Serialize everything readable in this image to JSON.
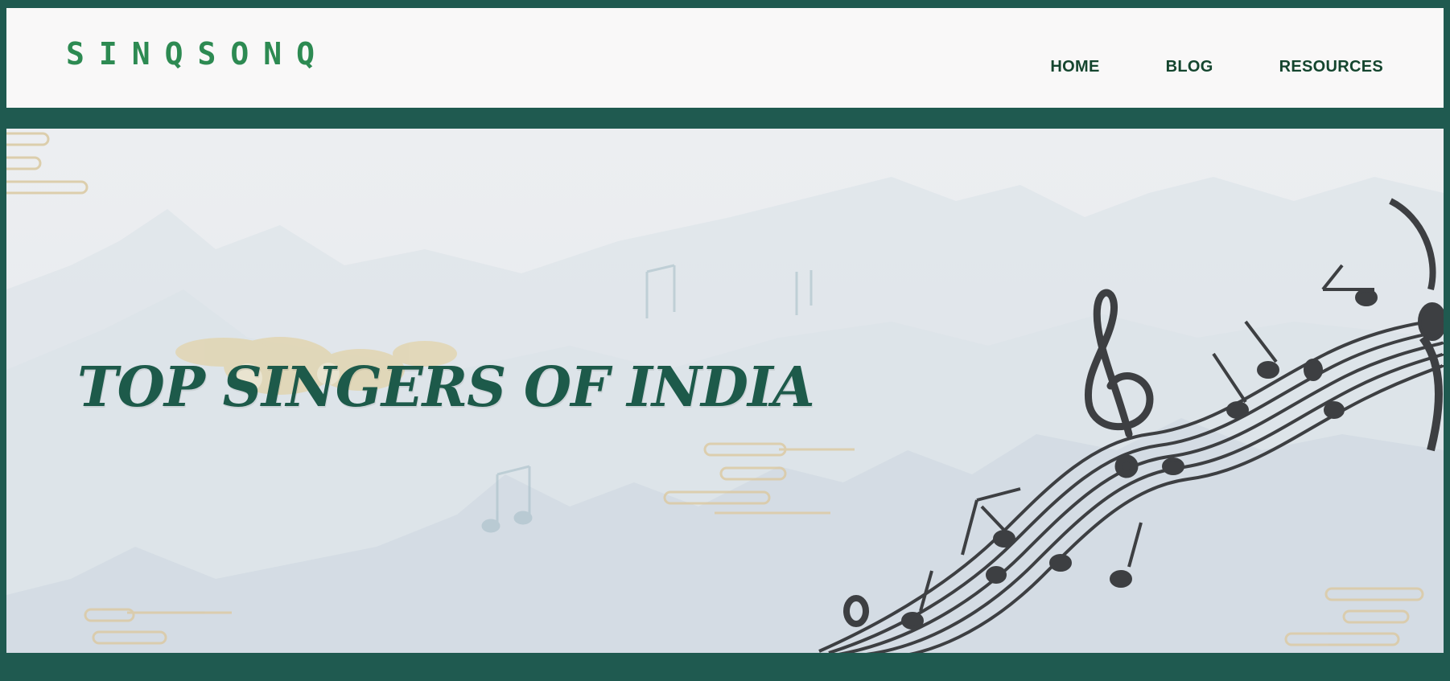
{
  "header": {
    "logo": "SINQSONQ",
    "nav": [
      {
        "label": "HOME"
      },
      {
        "label": "BLOG"
      },
      {
        "label": "RESOURCES"
      }
    ]
  },
  "hero": {
    "title": "TOP SINGERS OF INDIA",
    "decorations": [
      "mountain-silhouettes",
      "cloud-swirl-ornaments",
      "music-staff-with-notes",
      "treble-clef-icon"
    ]
  },
  "colors": {
    "frame": "#1f5a50",
    "header_bg": "#f9f8f8",
    "logo": "#2d8a52",
    "nav_text": "#14452e",
    "hero_title": "#1d5a4a",
    "staff": "#3d3f42"
  }
}
